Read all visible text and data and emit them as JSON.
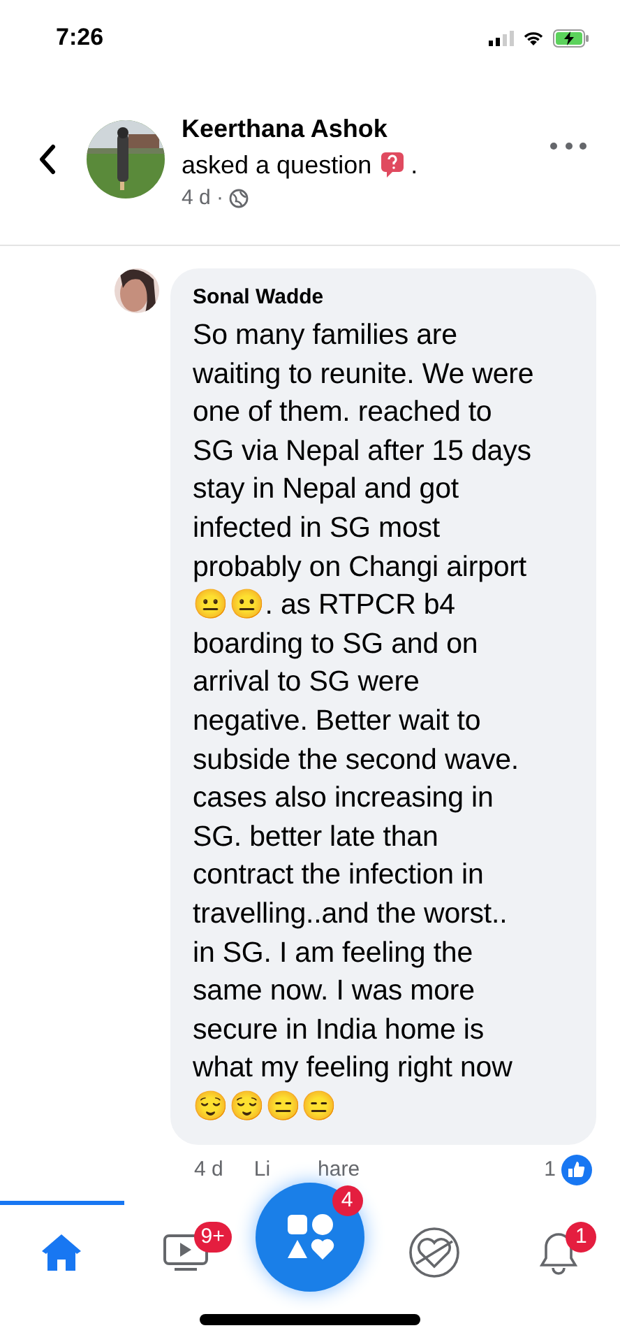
{
  "status_bar": {
    "time": "7:26"
  },
  "post": {
    "author": "Keerthana Ashok",
    "action": "asked a question",
    "action_end": ".",
    "time": "4 d ·"
  },
  "comment": {
    "author": "Sonal Wadde",
    "lines": [
      "So many families are",
      "waiting to reunite. We were",
      "one of them. reached to",
      "SG via Nepal after 15 days",
      "stay in Nepal and got",
      "infected in SG most",
      "probably on Changi airport",
      "😐😐. as RTPCR b4",
      "boarding to SG and on",
      "arrival to SG were",
      "negative. Better wait to",
      "subside the second wave.",
      "cases also increasing in",
      "SG. better late than",
      "contract the infection in",
      "travelling..and the worst..",
      "in SG. I am feeling the",
      "same now. I was more",
      "secure in India home is",
      "what my feeling right now",
      "😌😌😑😑"
    ]
  },
  "comment_actions": {
    "time": "4 d",
    "like": "Li",
    "share": "hare",
    "reactions": "1"
  },
  "tab_bar": {
    "tabs": [
      {
        "kind": "home",
        "selected": true
      },
      {
        "kind": "watch",
        "selected": false,
        "badge": "9+"
      },
      {
        "kind": "menu",
        "selected": false,
        "badge": "4"
      },
      {
        "kind": "dating",
        "selected": false
      },
      {
        "kind": "notifications",
        "selected": false,
        "badge": "1"
      }
    ]
  }
}
